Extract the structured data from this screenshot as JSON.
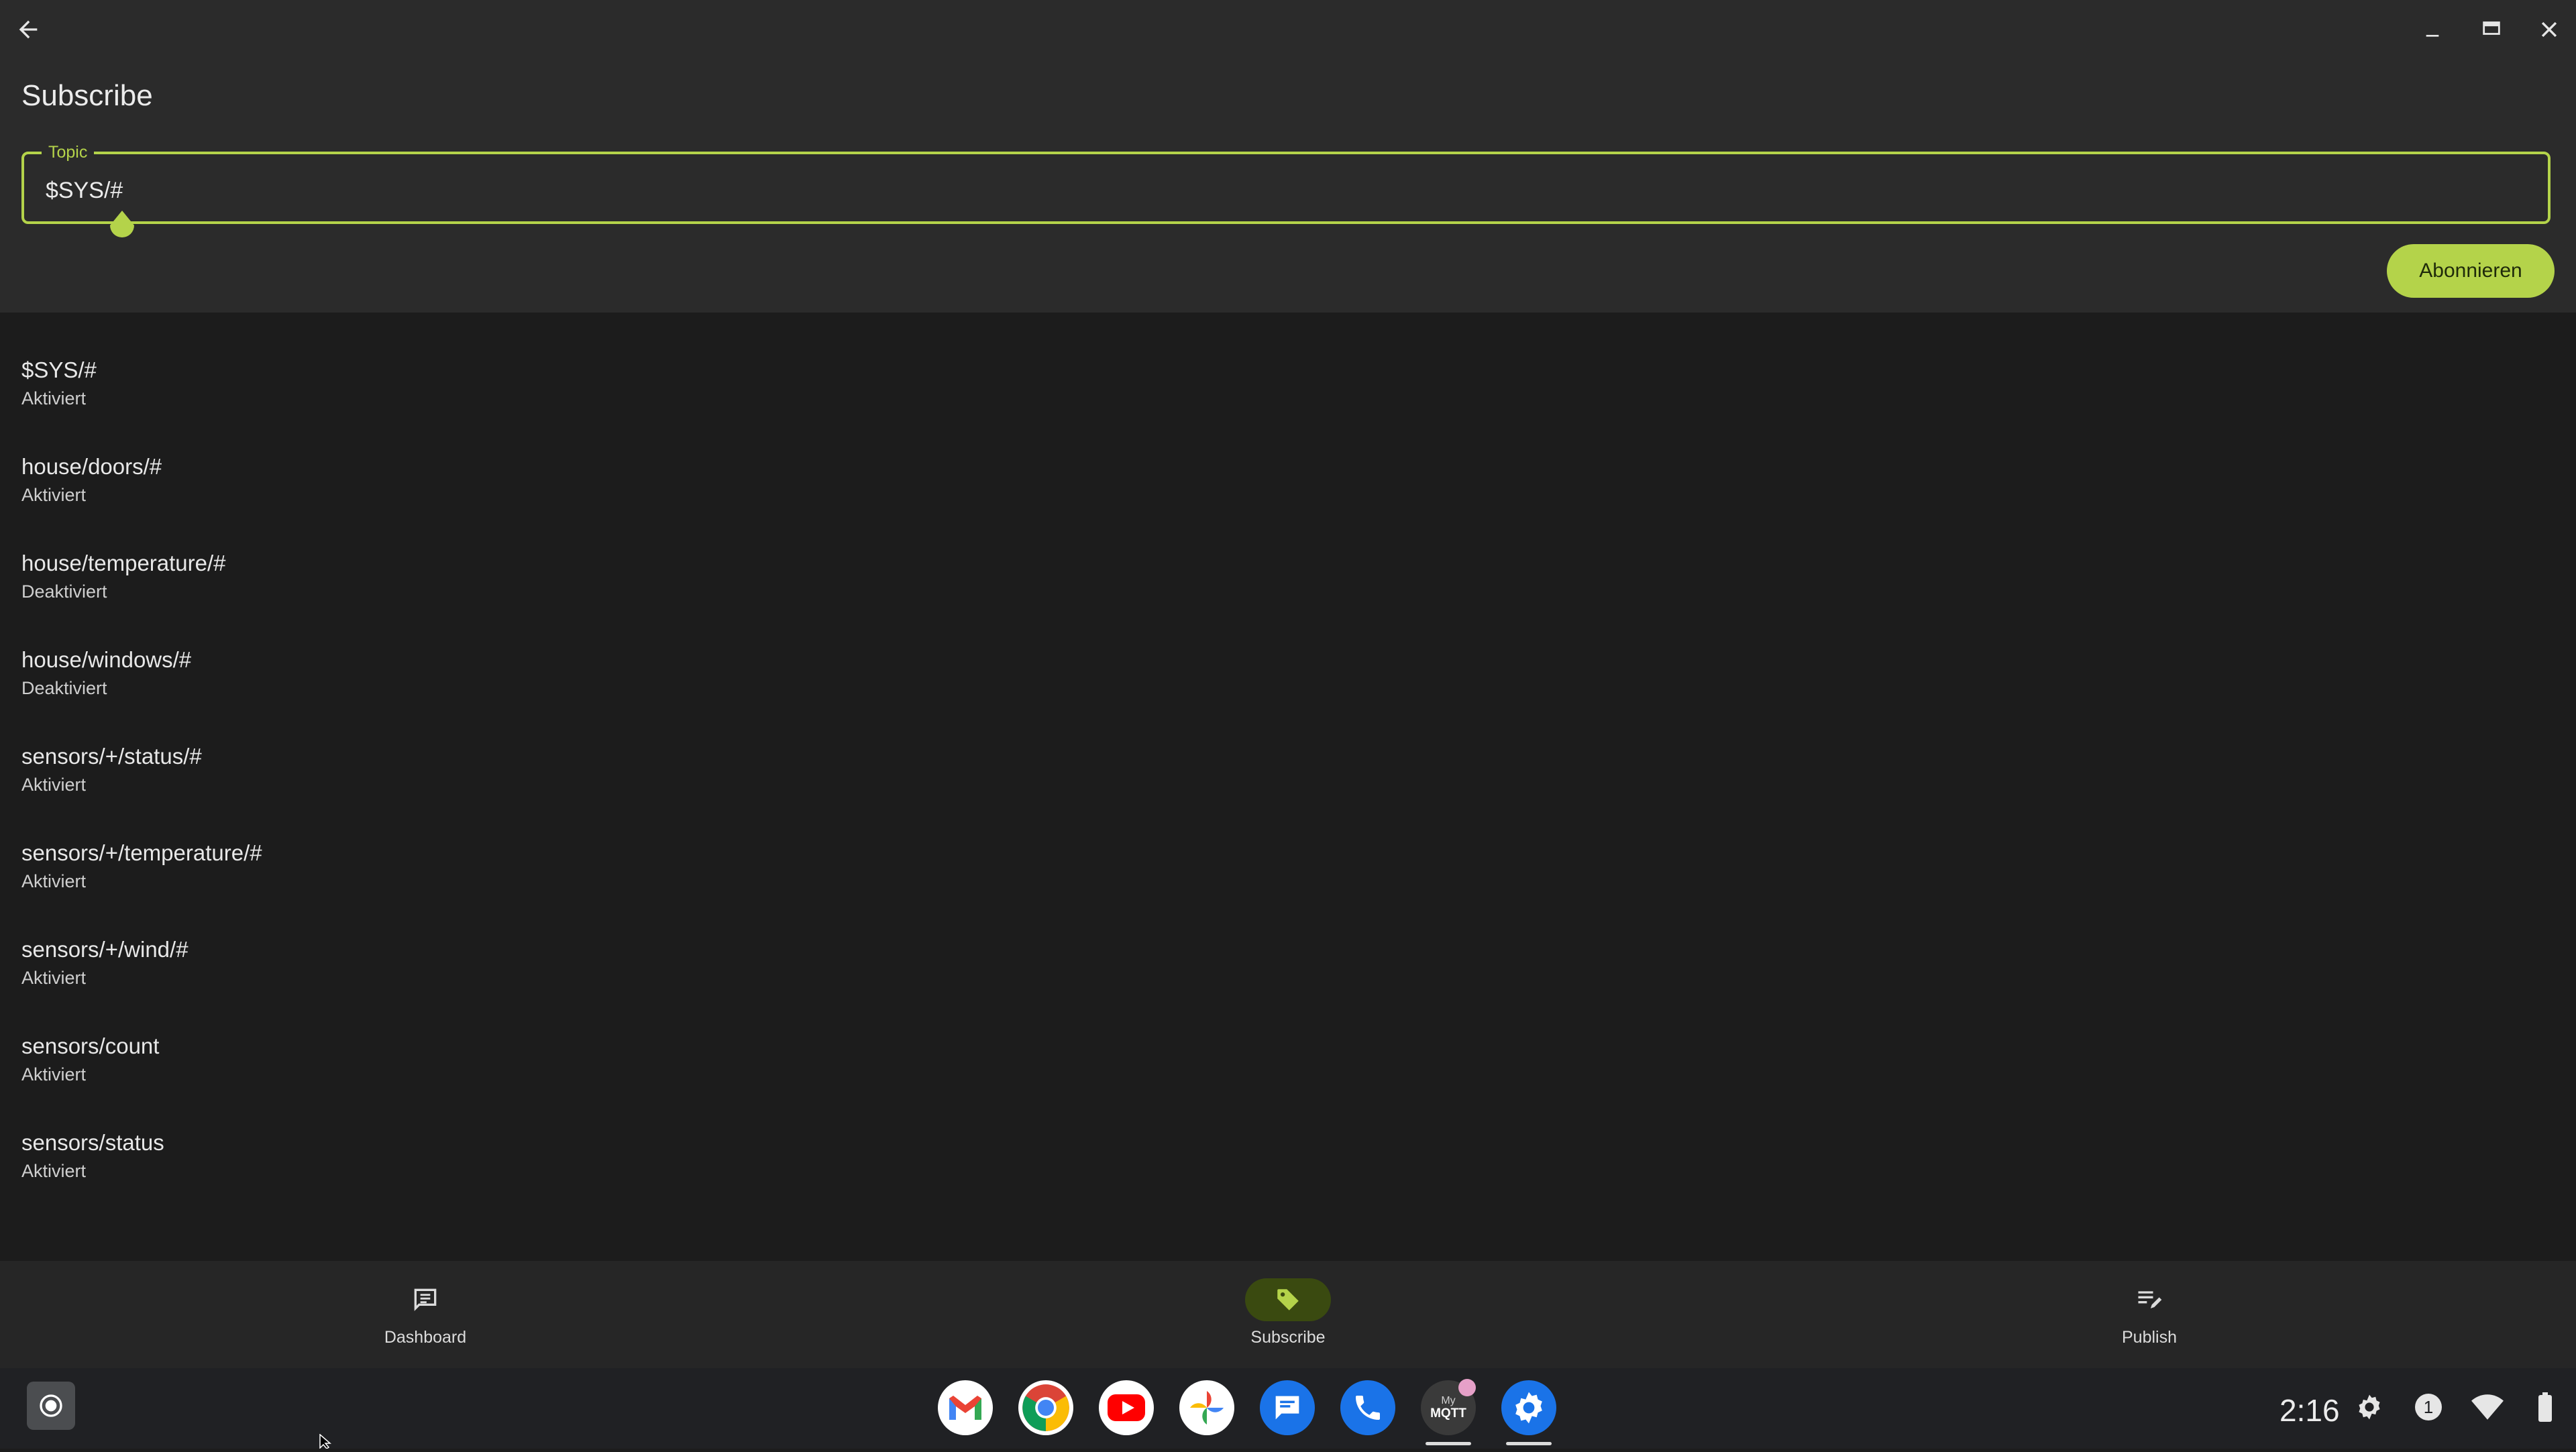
{
  "window": {
    "title": "Subscribe"
  },
  "topic_field": {
    "label": "Topic",
    "value": "$SYS/#"
  },
  "subscribe_button": {
    "label": "Abonnieren"
  },
  "subscriptions": [
    {
      "topic": "$SYS/#",
      "status": "Aktiviert"
    },
    {
      "topic": "house/doors/#",
      "status": "Aktiviert"
    },
    {
      "topic": "house/temperature/#",
      "status": "Deaktiviert"
    },
    {
      "topic": "house/windows/#",
      "status": "Deaktiviert"
    },
    {
      "topic": "sensors/+/status/#",
      "status": "Aktiviert"
    },
    {
      "topic": "sensors/+/temperature/#",
      "status": "Aktiviert"
    },
    {
      "topic": "sensors/+/wind/#",
      "status": "Aktiviert"
    },
    {
      "topic": "sensors/count",
      "status": "Aktiviert"
    },
    {
      "topic": "sensors/status",
      "status": "Aktiviert"
    }
  ],
  "bottom_nav": {
    "dashboard": "Dashboard",
    "subscribe": "Subscribe",
    "publish": "Publish"
  },
  "shelf": {
    "apps": [
      "gmail-icon",
      "chrome-icon",
      "youtube-icon",
      "photos-icon",
      "messages-icon",
      "phone-icon",
      "mymqtt-icon",
      "settings-icon"
    ],
    "mymqtt_logo": {
      "line1": "My",
      "line2": "MQTT"
    },
    "time": "2:16",
    "notification_count": "1"
  },
  "colors": {
    "accent": "#b4d34a",
    "app_bar": "#2b2b2b",
    "background": "#1c1c1c"
  }
}
